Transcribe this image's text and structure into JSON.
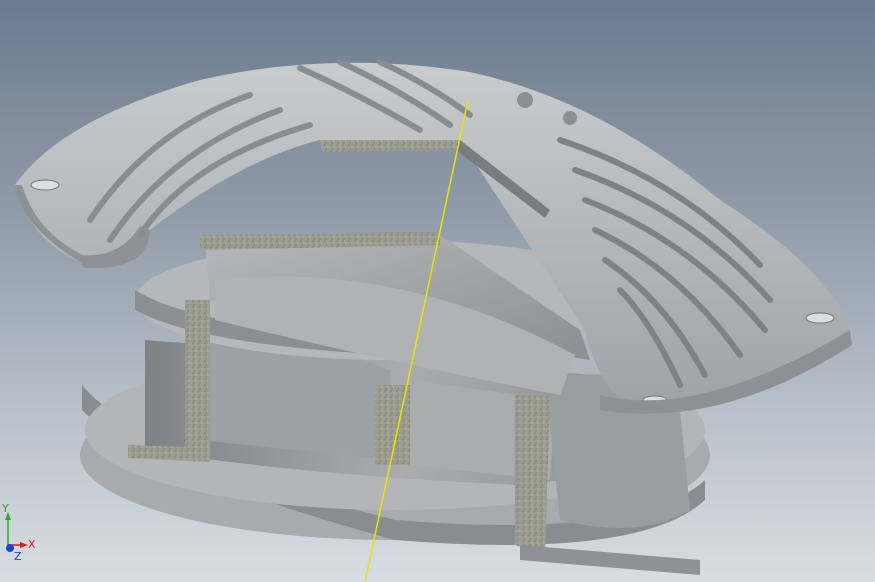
{
  "viewer": {
    "title": ""
  },
  "triad": {
    "x_label": "X",
    "y_label": "Y",
    "z_label": "Z",
    "x_color": "#d02020",
    "y_color": "#20b020",
    "z_color": "#2040d0"
  },
  "model": {
    "body_color": "#a7a9ab",
    "section_color": "#9a9a8a",
    "axis_line_color": "#e6e600"
  }
}
